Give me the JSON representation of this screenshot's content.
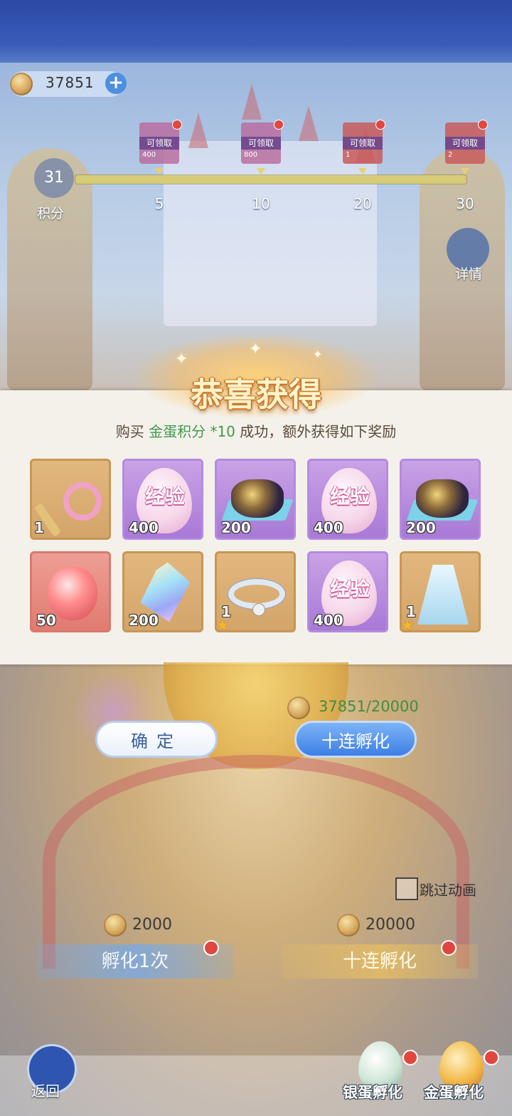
{
  "top_bar": {
    "currency_value": "37851",
    "plus": "+"
  },
  "progress": {
    "points_value": "31",
    "points_label": "积分",
    "milestones": [
      {
        "tag": "可领取",
        "amount": "400",
        "threshold": "5"
      },
      {
        "tag": "可领取",
        "amount": "800",
        "threshold": "10"
      },
      {
        "tag": "可领取",
        "amount": "1",
        "threshold": "20"
      },
      {
        "tag": "可领取",
        "amount": "2",
        "threshold": "30"
      }
    ]
  },
  "detail": {
    "label": "详情"
  },
  "modal": {
    "title": "恭喜获得",
    "message": {
      "prefix": "购买 ",
      "highlight": "金蛋积分 *10",
      "suffix": " 成功，额外获得如下奖励"
    },
    "rewards": [
      {
        "icon": "magic-wand-icon",
        "quantity": "1"
      },
      {
        "icon": "exp-egg-icon",
        "label": "经验",
        "quantity": "400"
      },
      {
        "icon": "star-ore-icon",
        "quantity": "200"
      },
      {
        "icon": "exp-egg-icon",
        "label": "经验",
        "quantity": "400"
      },
      {
        "icon": "star-ore-icon",
        "quantity": "200"
      },
      {
        "icon": "red-gem-egg-icon",
        "quantity": "50"
      },
      {
        "icon": "crystal-icon",
        "quantity": "200"
      },
      {
        "icon": "ring-icon",
        "quantity": "1",
        "star": "★"
      },
      {
        "icon": "exp-egg-icon",
        "label": "经验",
        "quantity": "400"
      },
      {
        "icon": "cape-icon",
        "quantity": "1",
        "star": "★"
      }
    ]
  },
  "hatch": {
    "current_cost": "37851/20000",
    "confirm_label": "确定",
    "ten_hatch_label": "十连孵化",
    "skip_label": "跳过动画",
    "single": {
      "cost": "2000",
      "label": "孵化1次"
    },
    "ten": {
      "cost": "20000",
      "label": "十连孵化"
    }
  },
  "bottom_nav": {
    "back_label": "返回",
    "silver_label": "银蛋孵化",
    "gold_label": "金蛋孵化"
  },
  "colors": {
    "accent_blue": "#3d7fe6",
    "highlight_green": "#3f9a4c",
    "title_orange": "#c7772c",
    "card_gold": "#d3a56a",
    "card_purple": "#a879d6"
  }
}
